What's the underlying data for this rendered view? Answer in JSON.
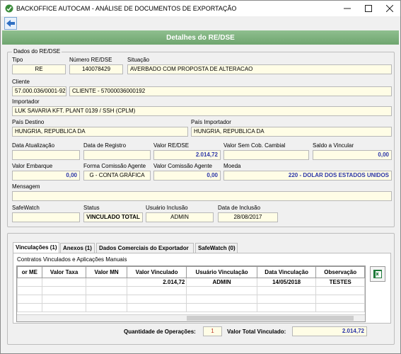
{
  "window": {
    "title": "BACKOFFICE AUTOCAM - ANÁLISE DE DOCUMENTOS DE EXPORTAÇÃO"
  },
  "header": {
    "title": "Detalhes do RE/DSE"
  },
  "dados": {
    "group_label": "Dados do RE/DSE",
    "tipo": {
      "label": "Tipo",
      "value": "RE"
    },
    "numero": {
      "label": "Número RE/DSE",
      "value": "140078429"
    },
    "situacao": {
      "label": "Situação",
      "value": "AVERBADO COM PROPOSTA DE ALTERACAO"
    },
    "cliente": {
      "label": "Cliente",
      "cnpj": "57.000.036/0001-92",
      "nome": "CLIENTE - 57000036000192"
    },
    "importador": {
      "label": "Importador",
      "value": "LUK SAVARIA KFT. PLANT 0139 / SSH (CPLM)"
    },
    "pais_destino": {
      "label": "País Destino",
      "value": "HUNGRIA, REPUBLICA DA"
    },
    "pais_importador": {
      "label": "País Importador",
      "value": "HUNGRIA, REPUBLICA DA"
    },
    "data_atualizacao": {
      "label": "Data Atualização",
      "value": ""
    },
    "data_registro": {
      "label": "Data de Registro",
      "value": ""
    },
    "valor_re": {
      "label": "Valor RE/DSE",
      "value": "2.014,72"
    },
    "valor_sem_cob": {
      "label": "Valor Sem Cob. Cambial",
      "value": ""
    },
    "saldo": {
      "label": "Saldo a Vincular",
      "value": "0,00"
    },
    "valor_embarque": {
      "label": "Valor Embarque",
      "value": "0,00"
    },
    "forma_comissao": {
      "label": "Forma Comissão Agente",
      "value": "G - CONTA GRÁFICA"
    },
    "valor_comissao": {
      "label": "Valor Comissão Agente",
      "value": "0,00"
    },
    "moeda": {
      "label": "Moeda",
      "value": "220 - DOLAR DOS ESTADOS UNIDOS"
    },
    "mensagem": {
      "label": "Mensagem",
      "value": ""
    },
    "safewatch": {
      "label": "SafeWatch",
      "value": ""
    },
    "status": {
      "label": "Status",
      "value": "VINCULADO TOTAL"
    },
    "usuario_inclusao": {
      "label": "Usuário Inclusão",
      "value": "ADMIN"
    },
    "data_inclusao": {
      "label": "Data de Inclusão",
      "value": "28/08/2017"
    }
  },
  "tabs": [
    {
      "label": "Vinculações (1)"
    },
    {
      "label": "Anexos (1)"
    },
    {
      "label": "Dados Comerciais do Exportador"
    },
    {
      "label": "SafeWatch (0)"
    }
  ],
  "grid": {
    "caption": "Contratos Vinculados e Aplicações Manuais",
    "columns": [
      "or ME",
      "Valor Taxa",
      "Valor MN",
      "Valor Vinculado",
      "Usuário Vinculação",
      "Data Vinculação",
      "Observação"
    ],
    "rows": [
      [
        "",
        "",
        "",
        "2.014,72",
        "ADMIN",
        "14/05/2018",
        "TESTES"
      ]
    ]
  },
  "footer": {
    "qtd_label": "Quantidade de Operações:",
    "qtd_value": "1",
    "total_label": "Valor Total Vinculado:",
    "total_value": "2.014,72"
  }
}
